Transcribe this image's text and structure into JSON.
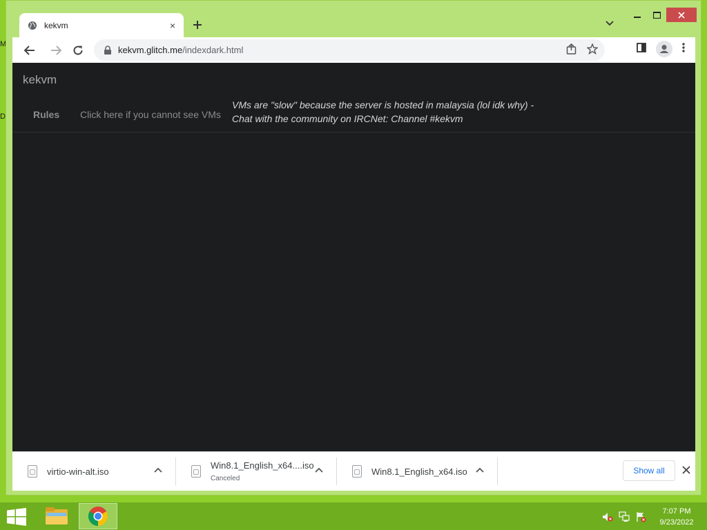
{
  "desktop": {
    "edge_labels": [
      "M",
      "D"
    ]
  },
  "window": {
    "minimize_icon": "minimize-icon",
    "maximize_icon": "maximize-icon",
    "close_icon": "close-icon"
  },
  "tab": {
    "title": "kekvm",
    "favicon": "globe-icon",
    "close_symbol": "×"
  },
  "toolbar": {
    "url_host": "kekvm.glitch.me",
    "url_path": "/indexdark.html"
  },
  "page": {
    "brand": "kekvm",
    "nav_rules": "Rules",
    "nav_help": "Click here if you cannot see VMs",
    "notice_line1": "VMs are \"slow\" because the server is hosted in malaysia (lol idk why) -",
    "notice_line2": "Chat with the community on IRCNet: Channel #kekvm"
  },
  "downloads": {
    "items": [
      {
        "name": "virtio-win-alt.iso",
        "status": ""
      },
      {
        "name": "Win8.1_English_x64....iso",
        "status": "Canceled"
      },
      {
        "name": "Win8.1_English_x64.iso",
        "status": ""
      }
    ],
    "show_all_label": "Show all"
  },
  "taskbar": {
    "time": "7:07 PM",
    "date": "9/23/2022"
  },
  "colors": {
    "page_bg": "#1c1d1f",
    "accent_link": "#1a73e8",
    "window_frame": "#b7e27a"
  }
}
